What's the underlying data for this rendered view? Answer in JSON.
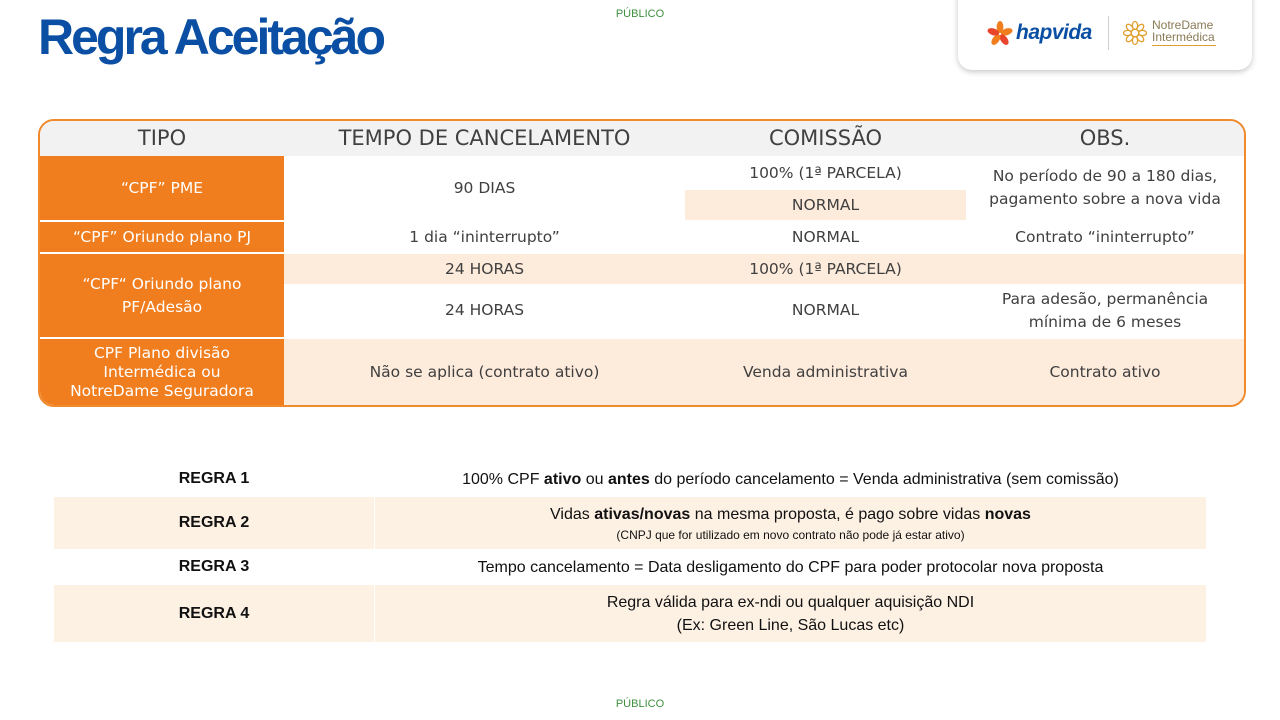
{
  "classification": "PÚBLICO",
  "title": "Regra Aceitação",
  "logos": {
    "hapvida": "hapvida",
    "notredame_line1": "NotreDame",
    "notredame_line2": "Intermédica"
  },
  "table": {
    "headers": {
      "tipo": "TIPO",
      "tempo": "TEMPO DE CANCELAMENTO",
      "comissao": "COMISSÃO",
      "obs": "OBS."
    },
    "row1": {
      "tipo": "“CPF” PME",
      "tempo": "90 DIAS",
      "comissao_a": "100% (1ª PARCELA)",
      "comissao_b": "NORMAL",
      "obs_line1": "No período de 90 a 180 dias,",
      "obs_line2": "pagamento sobre a nova vida"
    },
    "row2": {
      "tipo": "“CPF” Oriundo plano PJ",
      "tempo": "1 dia “ininterrupto”",
      "comissao": "NORMAL",
      "obs": "Contrato “ininterrupto”"
    },
    "row3": {
      "tipo_line1": "“CPF“ Oriundo plano",
      "tipo_line2": "PF/Adesão",
      "tempo_a": "24 HORAS",
      "comissao_a": "100% (1ª PARCELA)",
      "tempo_b": "24 HORAS",
      "comissao_b": "NORMAL",
      "obs_line1": "Para adesão, permanência",
      "obs_line2": "mínima de 6 meses"
    },
    "row4": {
      "tipo_line1": "CPF Plano divisão",
      "tipo_line2": "Intermédica ou",
      "tipo_line3": "NotreDame Seguradora",
      "tempo": "Não se aplica (contrato ativo)",
      "comissao": "Venda administrativa",
      "obs": "Contrato ativo"
    }
  },
  "rules": {
    "r1": {
      "name": "REGRA 1",
      "p1": "100% CPF ",
      "b1": "ativo",
      "p2": " ou ",
      "b2": "antes",
      "p3": " do período cancelamento = Venda administrativa (sem comissão)"
    },
    "r2": {
      "name": "REGRA 2",
      "p1": "Vidas ",
      "b1": "ativas/novas",
      "p2": " na mesma proposta, é pago sobre vidas ",
      "b2": "novas",
      "small": "(CNPJ que for utilizado em novo contrato não pode já estar ativo)"
    },
    "r3": {
      "name": "REGRA 3",
      "text": "Tempo cancelamento = Data desligamento do CPF para poder protocolar nova proposta"
    },
    "r4": {
      "name": "REGRA 4",
      "line1": "Regra válida para ex-ndi ou qualquer aquisição NDI",
      "line2": "(Ex: Green Line, São Lucas etc)"
    }
  },
  "colors": {
    "title_blue": "#0a4fa3",
    "orange": "#f07d1e",
    "peach": "#fdebdc",
    "classification_green": "#3f8f3f"
  }
}
